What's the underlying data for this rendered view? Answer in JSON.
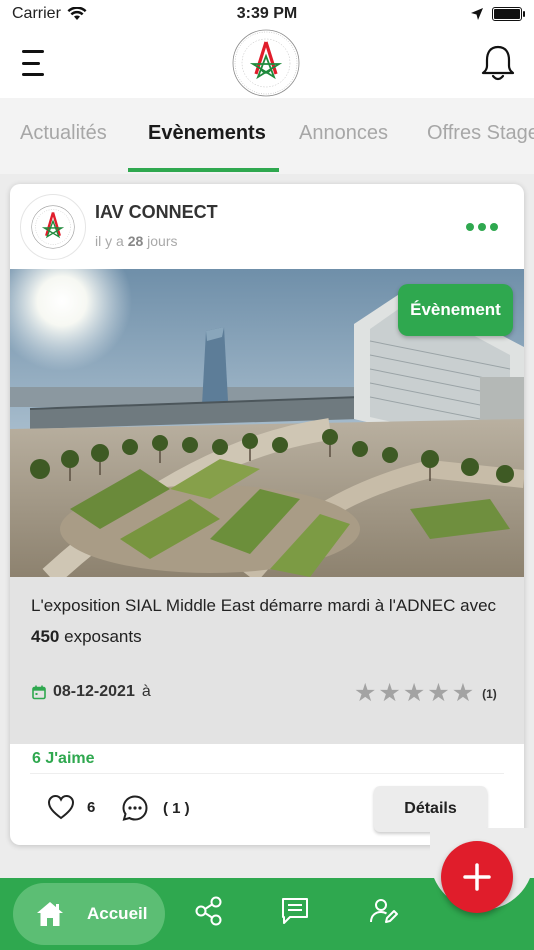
{
  "status_bar": {
    "carrier": "Carrier",
    "time": "3:39 PM",
    "battery_level": 1.0
  },
  "header": {
    "menu_icon": "hamburger-menu-icon",
    "logo_name": "iav-hassan-ii-logo",
    "notification_icon": "bell-icon"
  },
  "tabs": [
    {
      "label": "Actualités",
      "active": false
    },
    {
      "label": "Evènements",
      "active": true
    },
    {
      "label": "Annonces",
      "active": false
    },
    {
      "label": "Offres Stage",
      "active": false
    }
  ],
  "post": {
    "author": "IAV CONNECT",
    "time_prefix": "il y a",
    "time_value": "28",
    "time_unit": "jours",
    "badge": "Évènement",
    "title_part1": "L'exposition SIAL Middle East démarre mardi à l'ADNEC avec",
    "title_number": "450",
    "title_part2": "exposants",
    "date": "08-12-2021",
    "date_suffix": "à",
    "rating_stars": 5,
    "rating_count": "(1)",
    "likes_text": "6 J'aime",
    "like_count": "6",
    "comment_count": "( 1 )",
    "details_label": "Détails"
  },
  "bottom_nav": {
    "home_label": "Accueil",
    "items": [
      "home-icon",
      "share-network-icon",
      "message-icon",
      "edit-profile-icon"
    ],
    "fab_icon": "plus-icon"
  },
  "colors": {
    "accent": "#2fa84f",
    "fab": "#e01d2b",
    "tab_inactive": "#a7a7a7"
  }
}
